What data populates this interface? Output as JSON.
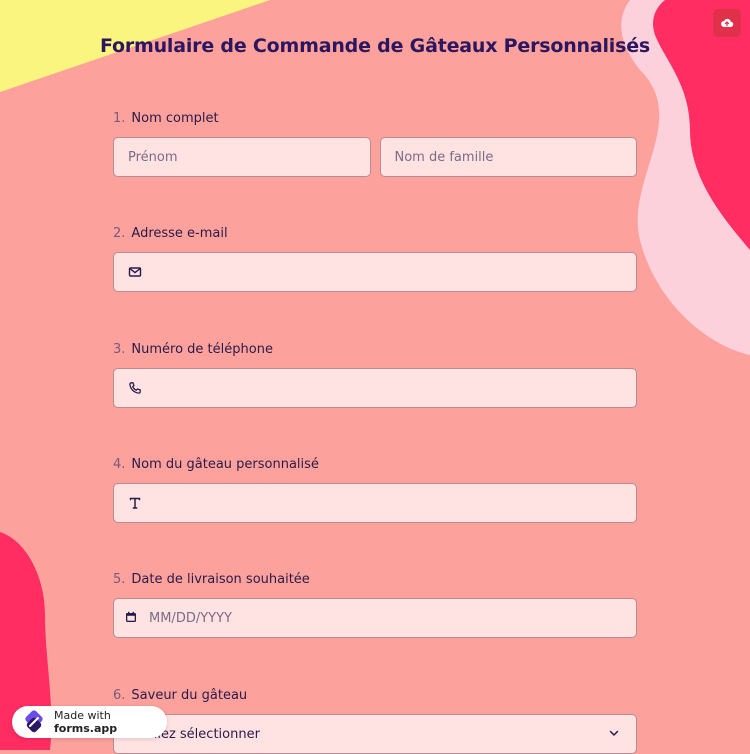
{
  "form": {
    "title": "Formulaire de Commande de Gâteaux Personnalisés"
  },
  "questions": {
    "q1": {
      "number": "1.",
      "label": "Nom complet",
      "first_placeholder": "Prénom",
      "last_placeholder": "Nom de famille"
    },
    "q2": {
      "number": "2.",
      "label": "Adresse e-mail",
      "icon": "mail-icon"
    },
    "q3": {
      "number": "3.",
      "label": "Numéro de téléphone",
      "icon": "phone-icon"
    },
    "q4": {
      "number": "4.",
      "label": "Nom du gâteau personnalisé",
      "icon": "text-icon"
    },
    "q5": {
      "number": "5.",
      "label": "Date de livraison souhaitée",
      "placeholder": "MM/DD/YYYY",
      "icon": "calendar-icon"
    },
    "q6": {
      "number": "6.",
      "label": "Saveur du gâteau",
      "placeholder": "Veuillez sélectionner",
      "icon": "chevron-down-icon"
    }
  },
  "badge": {
    "prefix": "Made with ",
    "brand": "forms.app"
  },
  "colors": {
    "background": "#fca19b",
    "title": "#2b1660",
    "field_background": "#ffe3e3",
    "accent_pink": "#ff2d62",
    "accent_yellow": "#f9f57e",
    "save_button": "#e0304a"
  },
  "toolbar": {
    "save_icon": "cloud-upload-icon"
  }
}
